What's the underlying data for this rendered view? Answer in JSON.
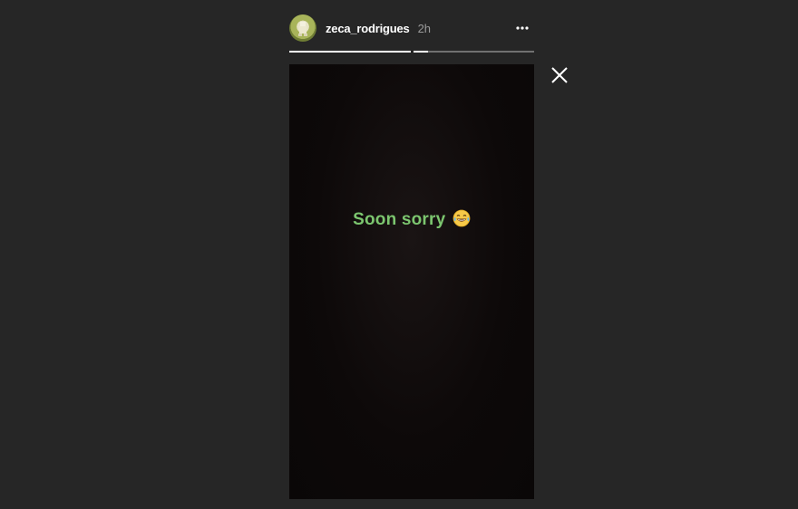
{
  "header": {
    "username": "zeca_rodrigues",
    "time": "2h",
    "avatar_icon": "profile-photo",
    "more_icon": "more-horizontal-icon"
  },
  "progress": {
    "segments": [
      1.0,
      0.12
    ],
    "fill_color": "#ffffff",
    "track_color": "rgba(255,255,255,0.35)"
  },
  "story": {
    "text": "Soon sorry",
    "emoji_icon": "face-with-tears-of-joy",
    "text_color": "#7cc66f"
  },
  "controls": {
    "close_icon": "close-icon"
  },
  "colors": {
    "background": "#262626",
    "story_background": "#0d0909"
  }
}
